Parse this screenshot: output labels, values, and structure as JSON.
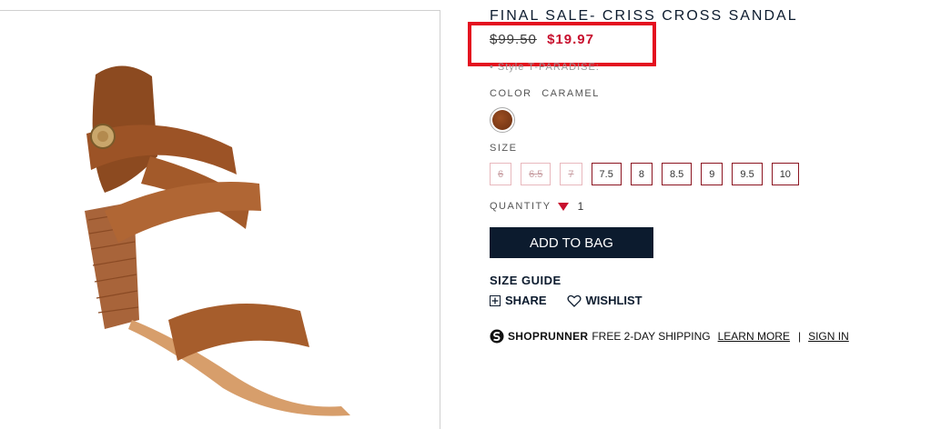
{
  "product": {
    "title": "FINAL SALE- CRISS CROSS SANDAL",
    "price_old": "$99.50",
    "price_new": "$19.97",
    "style_text": "• Style T-PARADISE:",
    "color_label": "COLOR",
    "color_value": "CARAMEL",
    "size_label": "SIZE",
    "sizes": [
      {
        "label": "6",
        "available": false
      },
      {
        "label": "6.5",
        "available": false
      },
      {
        "label": "7",
        "available": false
      },
      {
        "label": "7.5",
        "available": true
      },
      {
        "label": "8",
        "available": true
      },
      {
        "label": "8.5",
        "available": true
      },
      {
        "label": "9",
        "available": true
      },
      {
        "label": "9.5",
        "available": true
      },
      {
        "label": "10",
        "available": true
      }
    ],
    "quantity_label": "QUANTITY",
    "quantity_value": "1",
    "add_to_bag": "ADD TO BAG",
    "size_guide": "SIZE GUIDE",
    "share": "SHARE",
    "wishlist": "WISHLIST"
  },
  "shoprunner": {
    "brand": "SHOPRUNNER",
    "text": "FREE 2-DAY SHIPPING",
    "learn_more": "LEARN MORE",
    "separator": "|",
    "sign_in": "SIGN IN"
  },
  "colors": {
    "navy": "#0c1b2e",
    "sale_red": "#c8102e",
    "highlight_red": "#e4101f",
    "swatch": "#7a3a17"
  },
  "icons": {
    "share": "plus-box-icon",
    "wishlist": "heart-outline-icon",
    "shoprunner": "shoprunner-s-icon",
    "quantity": "triangle-down-icon"
  }
}
